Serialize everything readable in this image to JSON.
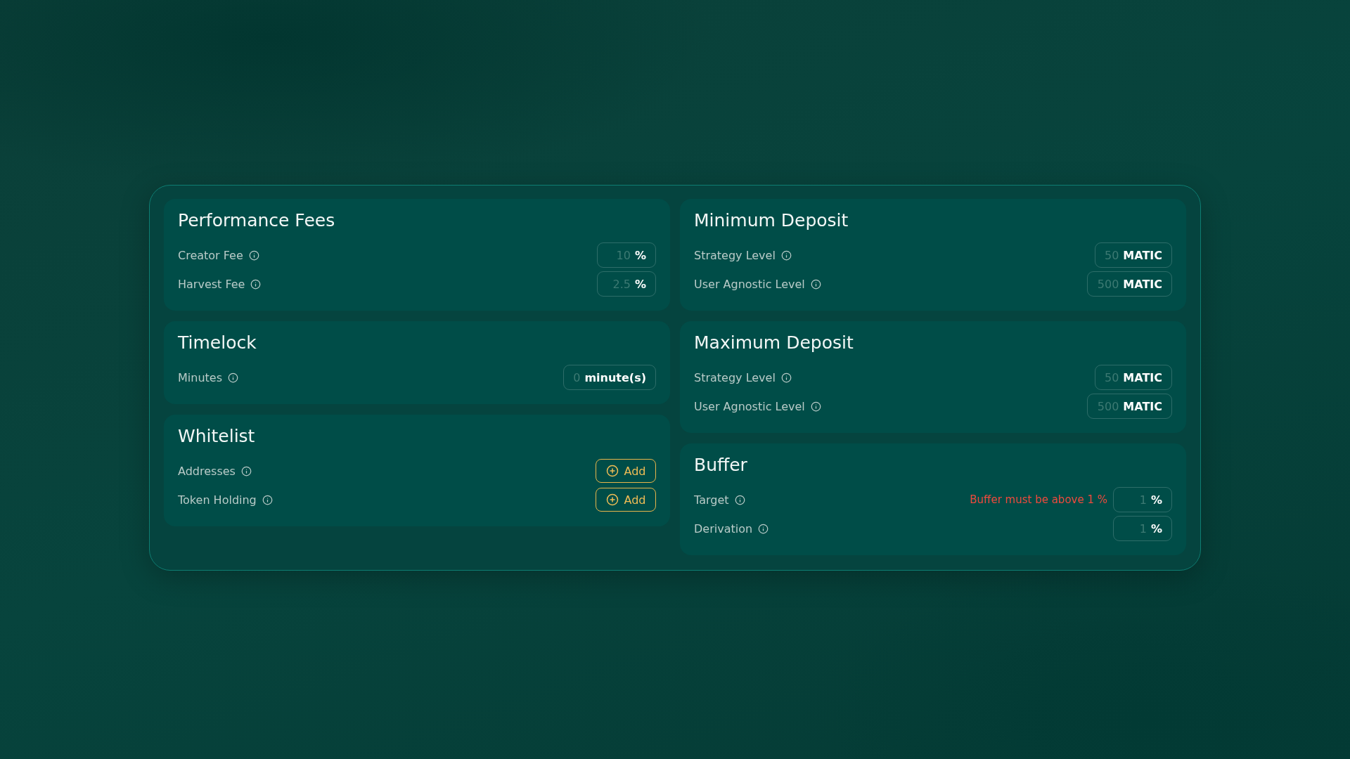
{
  "columns": [
    {
      "sections": [
        {
          "title": "Performance Fees",
          "rows": [
            {
              "kind": "input",
              "label": "Creator Fee",
              "placeholder": "10",
              "unit": "%"
            },
            {
              "kind": "input",
              "label": "Harvest Fee",
              "placeholder": "2.5",
              "unit": "%"
            }
          ]
        },
        {
          "title": "Timelock",
          "rows": [
            {
              "kind": "input",
              "label": "Minutes",
              "placeholder": "0",
              "unit": "minute(s)"
            }
          ]
        },
        {
          "title": "Whitelist",
          "rows": [
            {
              "kind": "add",
              "label": "Addresses",
              "button": "Add"
            },
            {
              "kind": "add",
              "label": "Token Holding",
              "button": "Add"
            }
          ]
        }
      ]
    },
    {
      "sections": [
        {
          "title": "Minimum Deposit",
          "rows": [
            {
              "kind": "input",
              "label": "Strategy Level",
              "placeholder": "50",
              "unit": "MATIC"
            },
            {
              "kind": "input",
              "label": "User Agnostic Level",
              "placeholder": "500",
              "unit": "MATIC"
            }
          ]
        },
        {
          "title": "Maximum Deposit",
          "rows": [
            {
              "kind": "input",
              "label": "Strategy Level",
              "placeholder": "50",
              "unit": "MATIC"
            },
            {
              "kind": "input",
              "label": "User Agnostic Level",
              "placeholder": "500",
              "unit": "MATIC"
            }
          ]
        },
        {
          "title": "Buffer",
          "rows": [
            {
              "kind": "input",
              "label": "Target",
              "placeholder": "1",
              "unit": "%",
              "error": "Buffer must be above 1 %"
            },
            {
              "kind": "input",
              "label": "Derivation",
              "placeholder": "1",
              "unit": "%"
            }
          ]
        }
      ]
    }
  ]
}
